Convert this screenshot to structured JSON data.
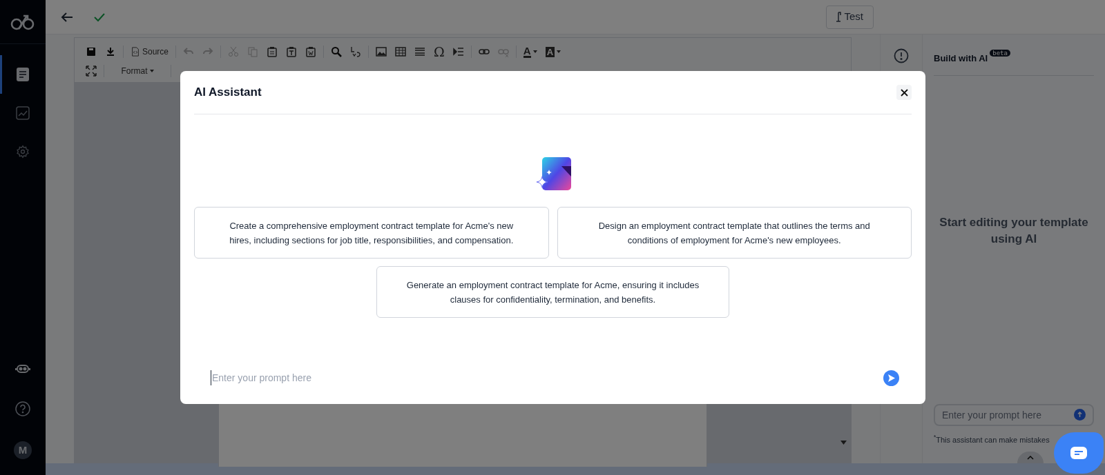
{
  "sidebar": {
    "nav": [
      {
        "kind": "document",
        "selected": true
      },
      {
        "kind": "chart",
        "selected": false
      },
      {
        "kind": "settings",
        "selected": false
      }
    ],
    "avatar": "M"
  },
  "top_bar": {
    "test_button": "Test"
  },
  "toolbar": {
    "row1": [
      {
        "kind": "save",
        "disabled": false
      },
      {
        "kind": "download",
        "disabled": false
      },
      {
        "kind": "separator"
      },
      {
        "kind": "source",
        "label": "Source",
        "disabled": false
      },
      {
        "kind": "separator"
      },
      {
        "kind": "undo",
        "disabled": true
      },
      {
        "kind": "redo",
        "disabled": true
      },
      {
        "kind": "separator"
      },
      {
        "kind": "cut",
        "disabled": true
      },
      {
        "kind": "copy",
        "disabled": true
      },
      {
        "kind": "paste",
        "disabled": false
      },
      {
        "kind": "pastetext",
        "disabled": false
      },
      {
        "kind": "pasteword",
        "disabled": false
      },
      {
        "kind": "separator"
      },
      {
        "kind": "find",
        "disabled": false
      },
      {
        "kind": "replace",
        "disabled": false
      },
      {
        "kind": "separator"
      },
      {
        "kind": "image",
        "disabled": false
      },
      {
        "kind": "table",
        "disabled": false
      },
      {
        "kind": "rule",
        "disabled": false
      },
      {
        "kind": "glyph",
        "label": "Ω",
        "disabled": false
      },
      {
        "kind": "blockquote",
        "disabled": false
      },
      {
        "kind": "separator"
      },
      {
        "kind": "link",
        "disabled": false
      },
      {
        "kind": "unlink",
        "disabled": true
      },
      {
        "kind": "separator"
      },
      {
        "kind": "textcolor",
        "label": "A",
        "disabled": false
      },
      {
        "kind": "bgcolor",
        "label": "A",
        "disabled": false
      }
    ],
    "row2": [
      {
        "kind": "maximize",
        "disabled": false
      },
      {
        "kind": "separator"
      },
      {
        "kind": "dropdown",
        "label": "Format",
        "disabled": false
      },
      {
        "kind": "separator"
      }
    ]
  },
  "right_panel": {
    "title": "Build with AI",
    "badge": "beta",
    "empty_message": "Start editing your template using AI",
    "prompt": {
      "placeholder": "Enter your prompt here"
    },
    "disclaimer": "$^{*}$This assistant can make mistakes"
  },
  "modal": {
    "title": "AI Assistant",
    "suggestions": [
      "Create a comprehensive employment contract template for Acme's new hires, including sections for job title, responsibilities, and compensation.",
      "Design an employment contract template that outlines the terms and conditions of employment for Acme's new employees.",
      "Generate an employment contract template for Acme, ensuring it includes clauses for confidentiality, termination, and benefits."
    ],
    "prompt": {
      "placeholder": "Enter your prompt here"
    }
  }
}
